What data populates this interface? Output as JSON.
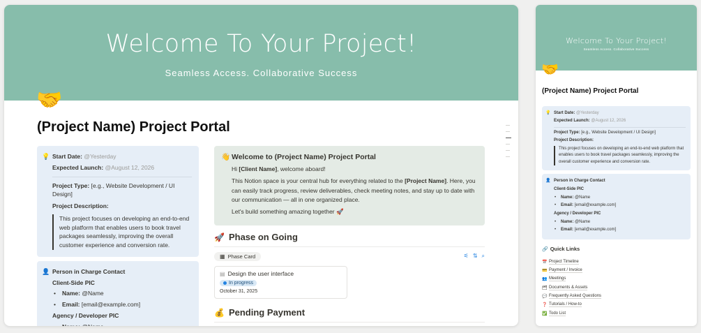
{
  "cover": {
    "title": "Welcome To Your Project!",
    "subtitle": "Seamless Access. Collaborative Success",
    "color": "#87bdab"
  },
  "page": {
    "icon": "handshake-icon",
    "icon_glyph": "🤝",
    "title": "(Project Name) Project Portal"
  },
  "info_card": {
    "start_date_label": "Start Date:",
    "start_date_value": "@Yesterday",
    "launch_label": "Expected Launch:",
    "launch_value": "@August 12, 2026",
    "project_type_label": "Project Type:",
    "project_type_value": "[e.g., Website Development / UI Design]",
    "description_label": "Project Description:",
    "description_value": "This project focuses on developing an end-to-end web platform that enables users to book travel packages seamlessly, improving the overall customer experience and conversion rate."
  },
  "contact_card": {
    "title": "Person in Charge Contact",
    "client_heading": "Client-Side PIC",
    "client_name_label": "Name:",
    "client_name_value": "@Name",
    "client_email_label": "Email:",
    "client_email_value": "[email@example.com]",
    "agency_heading": "Agency / Developer PIC",
    "agency_name_label": "Name:",
    "agency_name_value": "@Name",
    "agency_email_label": "Email:",
    "agency_email_value": "[email@example.com]"
  },
  "welcome": {
    "icon": "waving-hand-icon",
    "icon_glyph": "👋",
    "title": "Welcome to (Project Name) Project Portal",
    "greet_pre": "Hi ",
    "greet_bold": "[Client Name]",
    "greet_post": ", welcome aboard!",
    "p2_pre": "This Notion space is your central hub for everything related to the ",
    "p2_bold": "[Project Name]",
    "p2_post": ". Here, you can easily track progress, review deliverables, check meeting notes, and stay up to date with our communication — all in one organized place.",
    "p3": "Let's build something amazing together 🚀"
  },
  "phase": {
    "icon_glyph": "🚀",
    "title": "Phase on Going",
    "view_tab": "Phase Card",
    "card": {
      "title": "Design the user interface",
      "status": "In progress",
      "date": "October 31, 2025"
    }
  },
  "pending": {
    "icon_glyph": "💰",
    "title": "Pending Payment"
  },
  "quick_links": {
    "icon_glyph": "🔗",
    "title": "Quick Links",
    "items": [
      {
        "icon": "📅",
        "label": "Project Timeline"
      },
      {
        "icon": "💳",
        "label": "Payment / Invoice"
      },
      {
        "icon": "👥",
        "label": "Meetings"
      },
      {
        "icon": "🗂",
        "label": "Documents & Assets"
      },
      {
        "icon": "💬",
        "label": "Frequently Asked Questions"
      },
      {
        "icon": "❓",
        "label": "Tutorials / How-to"
      },
      {
        "icon": "✅",
        "label": "Todo List"
      }
    ]
  }
}
